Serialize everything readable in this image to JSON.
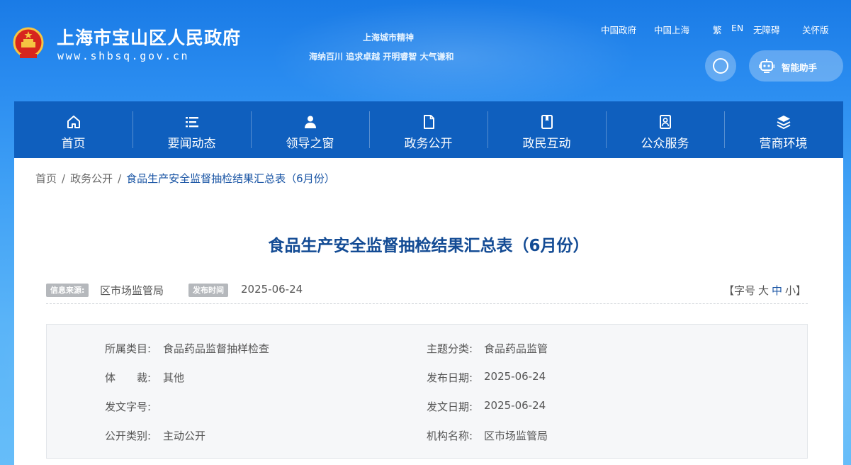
{
  "header": {
    "site_name": "上海市宝山区人民政府",
    "site_url": "www.shbsq.gov.cn",
    "spirit_title": "上海城市精神",
    "spirit_text": "海纳百川 追求卓越 开明睿智 大气谦和",
    "top_links": [
      "中国政府",
      "中国上海",
      "繁",
      "EN",
      "无障碍",
      "关怀版"
    ],
    "assistant_label": "智能助手"
  },
  "nav": {
    "items": [
      {
        "label": "首页",
        "icon": "home-icon"
      },
      {
        "label": "要闻动态",
        "icon": "list-icon"
      },
      {
        "label": "领导之窗",
        "icon": "person-icon"
      },
      {
        "label": "政务公开",
        "icon": "document-icon"
      },
      {
        "label": "政民互动",
        "icon": "book-icon"
      },
      {
        "label": "公众服务",
        "icon": "id-card-icon"
      },
      {
        "label": "营商环境",
        "icon": "layers-icon"
      }
    ]
  },
  "breadcrumb": {
    "items": [
      "首页",
      "政务公开",
      "食品生产安全监督抽检结果汇总表（6月份）"
    ],
    "separator": "/"
  },
  "article": {
    "title": "食品生产安全监督抽检结果汇总表（6月份）",
    "source_tag": "信息来源:",
    "source": "区市场监管局",
    "date_tag": "发布时间",
    "date": "2025-06-24",
    "font_size_open": "【字号",
    "font_size_large": "大",
    "font_size_medium": "中",
    "font_size_small": "小】"
  },
  "info": {
    "rows": [
      {
        "k1": "所属类目:",
        "v1": "食品药品监督抽样检查",
        "k2": "主题分类:",
        "v2": "食品药品监管"
      },
      {
        "k1": "体　　裁:",
        "v1": "其他",
        "k2": "发布日期:",
        "v2": "2025-06-24"
      },
      {
        "k1": "发文字号:",
        "v1": "",
        "k2": "发文日期:",
        "v2": "2025-06-24"
      },
      {
        "k1": "公开类别:",
        "v1": "主动公开",
        "k2": "机构名称:",
        "v2": "区市场监管局"
      }
    ]
  },
  "colors": {
    "nav_bg": "#0f5fbe",
    "title": "#134b94",
    "accent": "#1b56a5"
  }
}
